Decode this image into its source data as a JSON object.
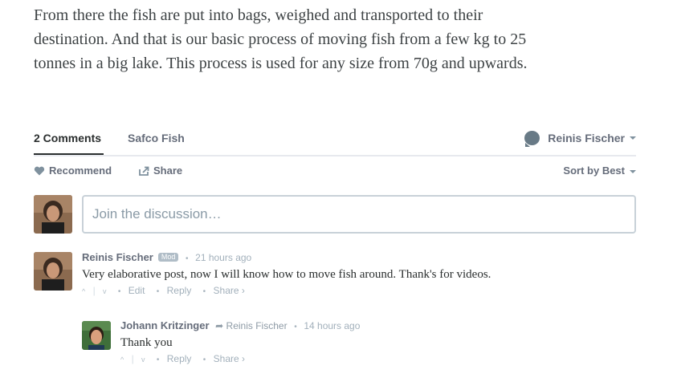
{
  "article": {
    "lines": [
      "From there the fish are put into bags, weighed and transported to their",
      "destination. And that is our basic process of moving fish from a few kg to 25",
      "tonnes in a big lake. This process is used for any size from 70g and upwards."
    ]
  },
  "nav": {
    "comments_tab": "2 Comments",
    "site_tab": "Safco Fish",
    "user_name": "Reinis Fischer"
  },
  "actions": {
    "recommend": "Recommend",
    "share": "Share",
    "sort": "Sort by Best"
  },
  "composer": {
    "placeholder": "Join the discussion…"
  },
  "comments": [
    {
      "author": "Reinis Fischer",
      "badge": "Mod",
      "time": "21 hours ago",
      "body": "Very elaborative post, now I will know how to move fish around. Thank's for videos.",
      "up": "^",
      "down": "v",
      "edit": "Edit",
      "reply": "Reply",
      "share": "Share ›"
    },
    {
      "author": "Johann Kritzinger",
      "reply_to": "Reinis Fischer",
      "time": "14 hours ago",
      "body": "Thank you",
      "up": "^",
      "down": "v",
      "reply": "Reply",
      "share": "Share ›"
    }
  ],
  "colors": {
    "text": "#2a2e2e",
    "muted": "#656c7a",
    "border": "#c8d1d8"
  }
}
